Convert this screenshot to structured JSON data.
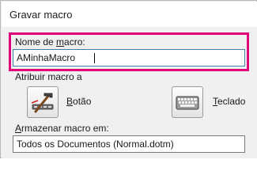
{
  "window": {
    "title": "Gravar macro"
  },
  "macro_name": {
    "label_pre": "Nome de ",
    "label_mnemonic": "m",
    "label_post": "acro:",
    "value": "AMinhaMacro"
  },
  "assign": {
    "label": "Atribuir macro a",
    "button": {
      "label_mnemonic": "B",
      "label_post": "otão",
      "icon": "toolbar-button-icon"
    },
    "keyboard": {
      "label_mnemonic": "T",
      "label_post": "eclado",
      "icon": "keyboard-icon"
    }
  },
  "store": {
    "label_mnemonic": "A",
    "label_post": "rmazenar macro em:",
    "value": "Todos os Documentos (Normal.dotm)"
  },
  "colors": {
    "highlight": "#e0007a"
  }
}
